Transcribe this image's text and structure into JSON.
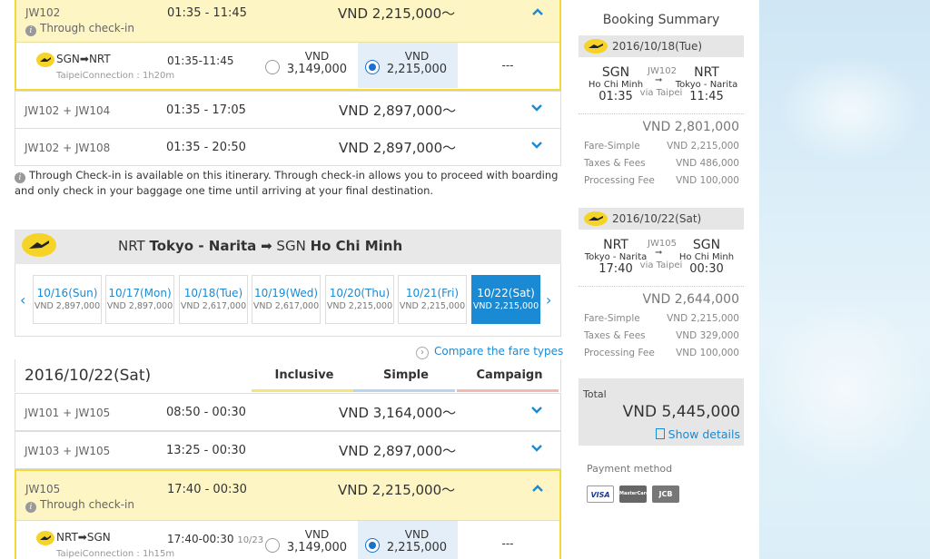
{
  "outbound": {
    "selected": {
      "flight_no": "JW102",
      "through_checkin": "Through check-in",
      "time": "01:35 - 11:45",
      "price": "VND 2,215,000〜",
      "segment": {
        "route": "SGN➡NRT",
        "connection": "TaipeiConnection : 1h20m",
        "time": "01:35-11:45",
        "opt1_currency": "VND",
        "opt1_amount": "3,149,000",
        "opt2_currency": "VND",
        "opt2_amount": "2,215,000",
        "opt3": "---"
      }
    },
    "rows": [
      {
        "flight_no": "JW102 + JW104",
        "time": "01:35 - 17:05",
        "price": "VND 2,897,000〜"
      },
      {
        "flight_no": "JW102 + JW108",
        "time": "01:35 - 20:50",
        "price": "VND 2,897,000〜"
      }
    ]
  },
  "note": "Through Check-in is available on this itinerary. Through check-in allows you to proceed with boarding and only check in your baggage one time until arriving at your final destination.",
  "return": {
    "header": {
      "from_code": "NRT",
      "from_name": "Tokyo - Narita",
      "arrow": "➡",
      "to_code": "SGN",
      "to_name": "Ho Chi Minh"
    },
    "dates": [
      {
        "date": "10/16(Sun)",
        "price": "VND 2,897,000"
      },
      {
        "date": "10/17(Mon)",
        "price": "VND 2,897,000"
      },
      {
        "date": "10/18(Tue)",
        "price": "VND 2,617,000"
      },
      {
        "date": "10/19(Wed)",
        "price": "VND 2,617,000"
      },
      {
        "date": "10/20(Thu)",
        "price": "VND 2,215,000"
      },
      {
        "date": "10/21(Fri)",
        "price": "VND 2,215,000"
      },
      {
        "date": "10/22(Sat)",
        "price": "VND 2,215,000"
      }
    ],
    "compare_label": "Compare the fare types",
    "selected_date": "2016/10/22(Sat)",
    "fare_types": [
      "Inclusive",
      "Simple",
      "Campaign"
    ],
    "fare_colors": [
      "#f2e57a",
      "#b9d4ef",
      "#f4b7b2"
    ],
    "rows": [
      {
        "flight_no": "JW101 + JW105",
        "time": "08:50 - 00:30",
        "price": "VND 3,164,000〜"
      },
      {
        "flight_no": "JW103 + JW105",
        "time": "13:25 - 00:30",
        "price": "VND 2,897,000〜"
      }
    ],
    "selected": {
      "flight_no": "JW105",
      "through_checkin": "Through check-in",
      "time": "17:40 - 00:30",
      "price": "VND 2,215,000〜",
      "segment": {
        "route": "NRT➡SGN",
        "connection": "TaipeiConnection : 1h15m",
        "time": "17:40-00:30",
        "time_note": "10/23",
        "opt1_currency": "VND",
        "opt1_amount": "3,149,000",
        "opt2_currency": "VND",
        "opt2_amount": "2,215,000",
        "opt3": "---"
      }
    }
  },
  "summary": {
    "title": "Booking Summary",
    "legs": [
      {
        "date": "2016/10/18(Tue)",
        "from": "SGN",
        "from_city": "Ho Chi Minh",
        "dep": "01:35",
        "flight_no": "JW102",
        "arrow": "➞",
        "via": "via Taipei",
        "to": "NRT",
        "to_city": "Tokyo - Narita",
        "arr": "11:45",
        "price": "VND 2,801,000",
        "lines": [
          {
            "label": "Fare-Simple",
            "value": "VND 2,215,000"
          },
          {
            "label": "Taxes & Fees",
            "value": "VND 486,000"
          },
          {
            "label": "Processing Fee",
            "value": "VND 100,000"
          }
        ]
      },
      {
        "date": "2016/10/22(Sat)",
        "from": "NRT",
        "from_city": "Tokyo - Narita",
        "dep": "17:40",
        "flight_no": "JW105",
        "arrow": "➞",
        "via": "via Taipei",
        "to": "SGN",
        "to_city": "Ho Chi Minh",
        "arr": "00:30",
        "price": "VND 2,644,000",
        "lines": [
          {
            "label": "Fare-Simple",
            "value": "VND 2,215,000"
          },
          {
            "label": "Taxes & Fees",
            "value": "VND 329,000"
          },
          {
            "label": "Processing Fee",
            "value": "VND 100,000"
          }
        ]
      }
    ],
    "total_label": "Total",
    "total": "VND 5,445,000",
    "show_details": "Show details",
    "payment_label": "Payment method",
    "cards": [
      "VISA",
      "MasterCard",
      "JCB"
    ]
  },
  "colors": {
    "accent": "#1a8ad4",
    "highlight_border": "#f2d83b",
    "highlight_bg": "#fdf5c4",
    "logo": "#f5d327"
  }
}
